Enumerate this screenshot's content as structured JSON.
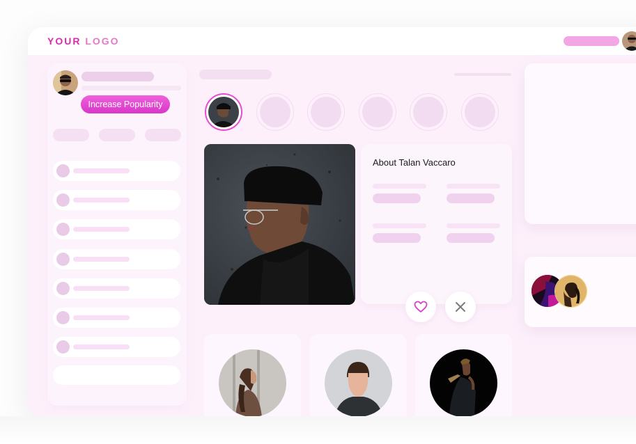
{
  "header": {
    "logo_part1": "YOUR ",
    "logo_part2": "LOGO",
    "user_avatar_icon": "user-avatar"
  },
  "sidebar": {
    "profile_avatar_icon": "user-avatar",
    "cta_label": "Increase Popularity",
    "chip_count": 3,
    "list_item_count": 7
  },
  "stories": {
    "count": 6,
    "active_index": 0
  },
  "profile": {
    "about_title": "About Talan Vaccaro",
    "like_icon": "heart-icon",
    "dismiss_icon": "close-icon"
  },
  "colors": {
    "brand": "#d92cae",
    "brand_light": "#e579c8",
    "cta": "#e44ed6",
    "background": "#fdf0fb",
    "placeholder": "#f0d2ee"
  }
}
